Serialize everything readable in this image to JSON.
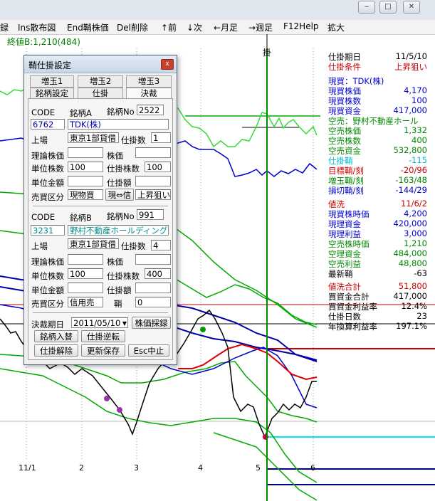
{
  "menu": [
    "録",
    "Ins散布図",
    "End鞘株価",
    "Del削除",
    "↑前",
    "↓次",
    "←月足",
    "→週足",
    "F12Help",
    "拡大"
  ],
  "window_buttons": [
    "‒",
    "□",
    "✕"
  ],
  "chart_header": "終値B:1,210(484)",
  "marker_label": "掛",
  "x_ticks": [
    "11/1",
    "2",
    "3",
    "4",
    "5",
    "6"
  ],
  "right_panel": [
    {
      "label": "仕掛期日",
      "value": "11/5/10",
      "color": "#000000"
    },
    {
      "label": "仕掛条件",
      "value": "上昇狙い",
      "color": "#cc0000"
    },
    {
      "label": "現買：TDK(株)",
      "value": "",
      "color": "#0000cc"
    },
    {
      "label": "現買株価",
      "value": "4,170",
      "color": "#0000cc"
    },
    {
      "label": "現買株数",
      "value": "100",
      "color": "#0000cc"
    },
    {
      "label": "現買資金",
      "value": "417,000",
      "color": "#0000cc"
    },
    {
      "label": "空売：野村不動産ホール",
      "value": "",
      "color": "#008800"
    },
    {
      "label": "空売株価",
      "value": "1,332",
      "color": "#008800"
    },
    {
      "label": "空売株数",
      "value": "400",
      "color": "#008800"
    },
    {
      "label": "空売資金",
      "value": "532,800",
      "color": "#008800"
    },
    {
      "label": "仕掛鞘",
      "value": "-115",
      "color": "#00b8d8"
    },
    {
      "label": "目標鞘/刻",
      "value": "-20/96",
      "color": "#cc0000"
    },
    {
      "label": "増玉鞘/刻",
      "value": "-163/48",
      "color": "#008800"
    },
    {
      "label": "損切鞘/刻",
      "value": "-144/29",
      "color": "#0000cc"
    },
    {
      "label": "値洗",
      "value": "11/6/2",
      "color": "#cc0000"
    },
    {
      "label": "現買株時価",
      "value": "4,200",
      "color": "#0000cc"
    },
    {
      "label": "現理資金",
      "value": "420,000",
      "color": "#0000cc"
    },
    {
      "label": "現理利益",
      "value": "3,000",
      "color": "#0000cc"
    },
    {
      "label": "空売株時価",
      "value": "1,210",
      "color": "#008800"
    },
    {
      "label": "空理資金",
      "value": "484,000",
      "color": "#008800"
    },
    {
      "label": "空売利益",
      "value": "48,800",
      "color": "#008800"
    },
    {
      "label": "最新鞘",
      "value": "-63",
      "color": "#000000"
    },
    {
      "label": "値洗合計",
      "value": "51,800",
      "color": "#cc0000"
    },
    {
      "label": "買資金合計",
      "value": "417,000",
      "color": "#000000"
    },
    {
      "label": "買資金利益率",
      "value": "12.4%",
      "color": "#000000"
    },
    {
      "label": "仕掛日数",
      "value": "23",
      "color": "#000000"
    },
    {
      "label": "年換算利益率",
      "value": "197.1%",
      "color": "#000000"
    }
  ],
  "dialog": {
    "title": "鞘仕掛設定",
    "close": "x",
    "tabs_row1": [
      "増玉1",
      "増玉2",
      "増玉3"
    ],
    "tabs_row2": [
      "銘柄設定",
      "仕掛",
      "決裁"
    ],
    "a": {
      "code_label": "CODE",
      "name_label": "銘柄A",
      "no_label": "銘柄No",
      "no": "2522",
      "code": "6762",
      "name": "TDK(株)",
      "market_label": "上場",
      "market": "東京1部貸借",
      "shares_label": "仕掛数",
      "shares": "1",
      "theory_label": "理論株価",
      "theory": "",
      "price_label": "株価",
      "price": "",
      "unit_label": "単位株数",
      "unit": "100",
      "pos_shares_label": "仕掛株数",
      "pos_shares": "100",
      "unit_amt_label": "単位金額",
      "unit_amt": "",
      "pos_amt_label": "仕掛額",
      "pos_amt": "",
      "trade_label": "売買区分",
      "trade": "現物買",
      "swap_btn": "現⇔信",
      "cond": "上昇狙い"
    },
    "b": {
      "code_label": "CODE",
      "name_label": "銘柄B",
      "no_label": "銘柄No",
      "no": "991",
      "code": "3231",
      "name": "野村不動産ホールディング",
      "market_label": "上場",
      "market": "東京1部貸借",
      "shares_label": "仕掛数",
      "shares": "4",
      "theory_label": "理論株価",
      "theory": "",
      "price_label": "株価",
      "price": "",
      "unit_label": "単位株数",
      "unit": "100",
      "pos_shares_label": "仕掛株数",
      "pos_shares": "400",
      "unit_amt_label": "単位金額",
      "unit_amt": "",
      "pos_amt_label": "仕掛額",
      "pos_amt": "",
      "trade_label": "売買区分",
      "trade": "信用売",
      "spread_label": "鞘",
      "spread": "0"
    },
    "settle_label": "決裁期日",
    "settle_date": "2011/05/10",
    "buttons": [
      "株価採録",
      "銘柄入替",
      "仕掛逆転",
      "仕掛解除",
      "更新保存",
      "Esc中止"
    ]
  }
}
